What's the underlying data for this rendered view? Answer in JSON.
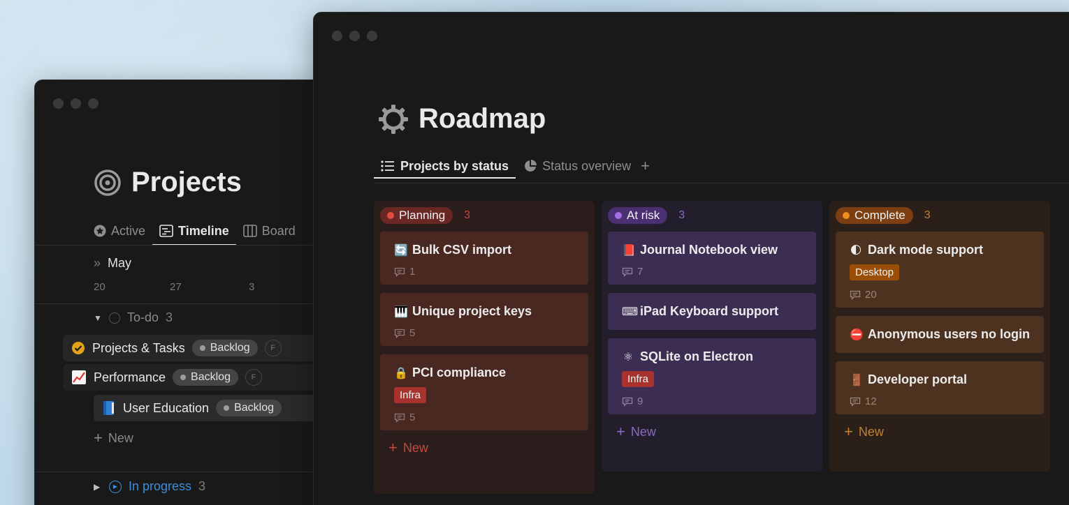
{
  "projects": {
    "title": "Projects",
    "tabs": [
      {
        "label": "Active",
        "icon": "star-circle-icon"
      },
      {
        "label": "Timeline",
        "icon": "timeline-icon"
      },
      {
        "label": "Board",
        "icon": "board-icon"
      }
    ],
    "timeline": {
      "month": "May",
      "days": [
        "20",
        "27",
        "3"
      ]
    },
    "groups": {
      "todo": {
        "label": "To-do",
        "count": "3"
      },
      "in_progress": {
        "label": "In progress",
        "count": "3"
      }
    },
    "rows": [
      {
        "title": "Projects & Tasks",
        "status": "Backlog",
        "avatar": "F",
        "icon": "check-circle-icon"
      },
      {
        "title": "Performance",
        "status": "Backlog",
        "avatar": "F",
        "icon": "chart-increasing-icon"
      },
      {
        "title": "User Education",
        "status": "Backlog",
        "icon": "blue-book-icon"
      }
    ],
    "new_label": "New"
  },
  "roadmap": {
    "title": "Roadmap",
    "tabs": [
      {
        "label": "Projects by status",
        "icon": "list-icon"
      },
      {
        "label": "Status overview",
        "icon": "pie-chart-icon"
      }
    ],
    "columns": [
      {
        "status": "Planning",
        "count": "3",
        "color": "#e24d42",
        "cards": [
          {
            "title": "Bulk CSV import",
            "emoji": "🔄",
            "comments": "1"
          },
          {
            "title": "Unique project keys",
            "emoji": "🎹",
            "comments": "5"
          },
          {
            "title": "PCI compliance",
            "emoji": "🔒",
            "tag": "Infra",
            "comments": "5"
          }
        ],
        "new_label": "New"
      },
      {
        "status": "At risk",
        "count": "3",
        "color": "#a56ee8",
        "cards": [
          {
            "title": "Journal Notebook view",
            "emoji": "📕",
            "comments": "7"
          },
          {
            "title": "iPad Keyboard support",
            "emoji": "⌨"
          },
          {
            "title": "SQLite on Electron",
            "emoji": "⚛",
            "tag": "Infra",
            "comments": "9"
          }
        ],
        "new_label": "New"
      },
      {
        "status": "Complete",
        "count": "3",
        "color": "#f08e1e",
        "cards": [
          {
            "title": "Dark mode support",
            "emoji": "🌓",
            "tag": "Desktop",
            "comments": "20"
          },
          {
            "title": "Anonymous users no login",
            "emoji": "⛔"
          },
          {
            "title": "Developer portal",
            "emoji": "🚪",
            "comments": "12"
          }
        ],
        "new_label": "New"
      }
    ]
  }
}
